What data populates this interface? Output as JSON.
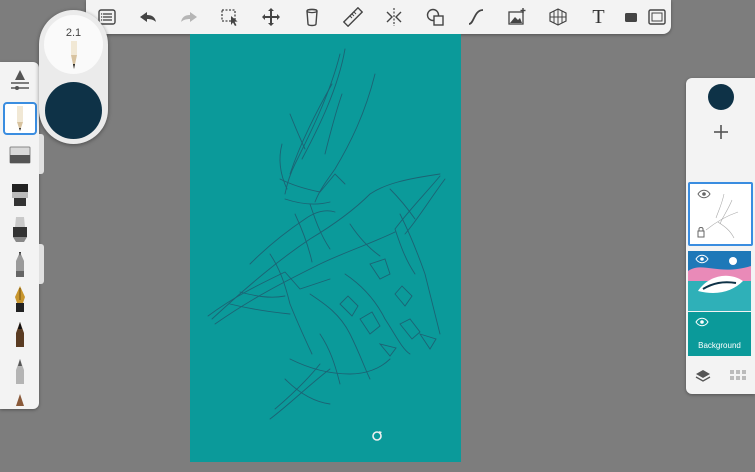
{
  "toolbar": {
    "tools": [
      "layers-list-icon",
      "undo-icon",
      "redo-icon",
      "selection-icon",
      "transform-icon",
      "fill-icon",
      "ruler-icon",
      "symmetry-icon",
      "shape-icon",
      "curve-icon",
      "image-icon",
      "perspective-icon",
      "text-icon",
      "toggle-ui-icon",
      "fullscreen-icon"
    ],
    "text_tool_label": "T"
  },
  "brush_puck": {
    "size_value": "2.1",
    "color": "#0e3247"
  },
  "canvas": {
    "background": "#0b9a9a"
  },
  "layers_panel": {
    "current_color": "#0e3247",
    "background_layer_label": "Background"
  },
  "colors": {
    "accent": "#3a8de0",
    "panel": "#f3f3f3",
    "workspace": "#7d7d7d"
  }
}
